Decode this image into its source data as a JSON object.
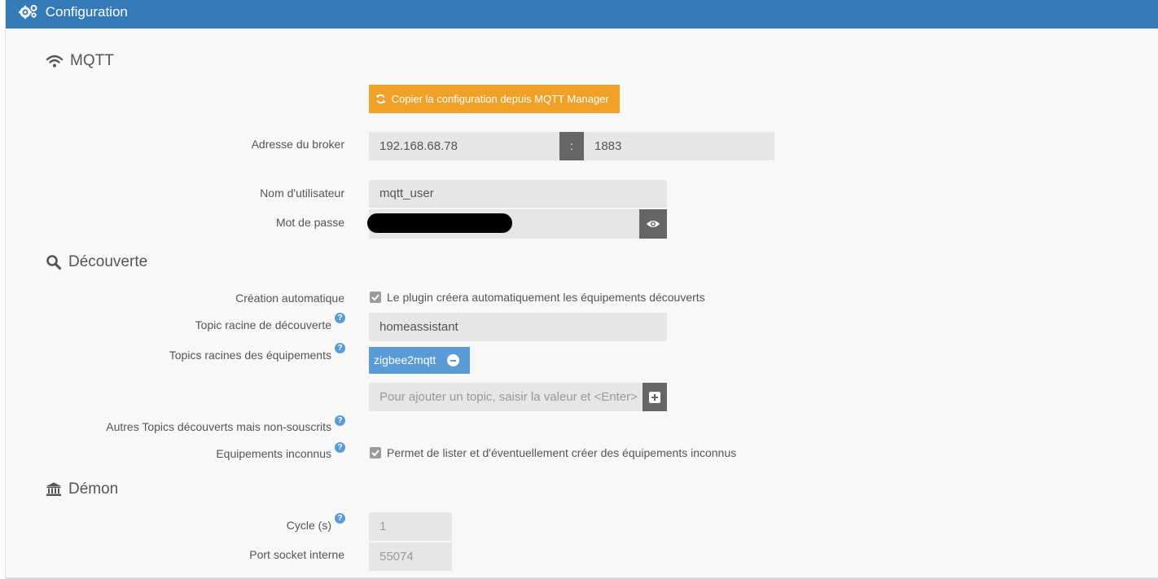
{
  "header": {
    "title": "Configuration",
    "icon": "gears-icon"
  },
  "sections": {
    "mqtt": {
      "title": "MQTT",
      "icon": "wifi-icon"
    },
    "discovery": {
      "title": "Découverte",
      "icon": "search-icon"
    },
    "daemon": {
      "title": "Démon",
      "icon": "institution-icon"
    }
  },
  "mqtt": {
    "copy_button": "Copier la configuration depuis MQTT Manager",
    "broker_label": "Adresse du broker",
    "broker_host": "192.168.68.78",
    "broker_separator": ":",
    "broker_port": "1883",
    "username_label": "Nom d'utilisateur",
    "username": "mqtt_user",
    "password_label": "Mot de passe"
  },
  "discovery": {
    "auto_create_label": "Création automatique",
    "auto_create_text": "Le plugin créera automatiquement les équipements découverts",
    "root_topic_label": "Topic racine de découverte",
    "root_topic": "homeassistant",
    "device_topics_label": "Topics racines des équipements",
    "device_topics": [
      "zigbee2mqtt"
    ],
    "add_topic_placeholder": "Pour ajouter un topic, saisir la valeur et <Enter>",
    "other_topics_label": "Autres Topics découverts mais non-souscrits",
    "unknown_devices_label": "Equipements inconnus",
    "unknown_devices_text": "Permet de lister et d'éventuellement créer des équipements inconnus"
  },
  "daemon": {
    "cycle_label": "Cycle (s)",
    "cycle": "1",
    "socket_port_label": "Port socket interne",
    "socket_port": "55074"
  },
  "help_symbol": "?",
  "colors": {
    "header": "#337ab7",
    "copy_button": "#f0a128",
    "tag": "#5b9bd5",
    "help": "#5b9bd5"
  }
}
